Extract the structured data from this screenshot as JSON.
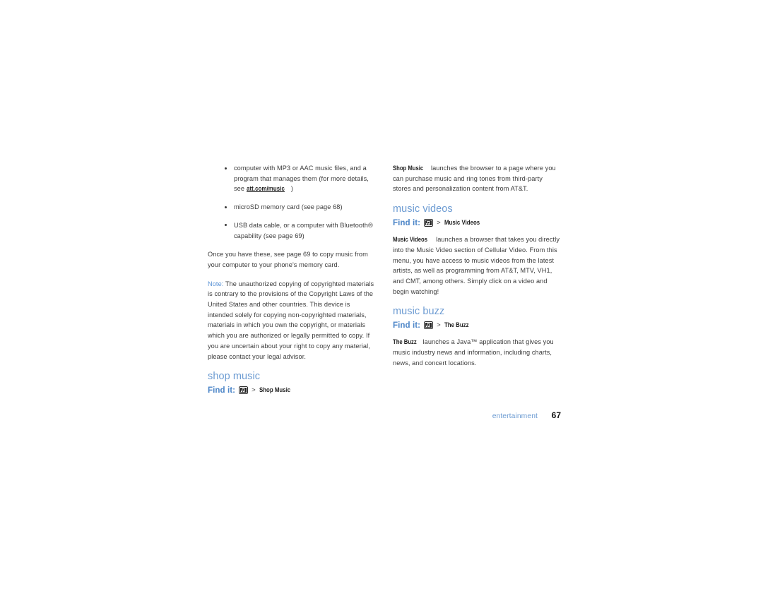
{
  "page": {
    "footer_chapter": "entertainment",
    "footer_page_number": "67"
  },
  "left_column": {
    "bullets": [
      {
        "pre": "computer with MP3 or AAC music files, and a program that manages them (for more details, see ",
        "link": "att.com/music",
        "post": ")"
      },
      {
        "pre": "microSD memory card (see page 68)",
        "link": "",
        "post": ""
      },
      {
        "pre": "USB data cable, or a computer with Bluetooth® capability (see page 69)",
        "link": "",
        "post": ""
      }
    ],
    "paragraph_copy_music": "Once you have these, see page 69 to copy music from your computer to your phone's memory card.",
    "note_label": "Note:",
    "note_text": " The unauthorized copying of copyrighted materials is contrary to the provisions of the Copyright Laws of the United States and other countries. This device is intended solely for copying non-copyrighted materials, materials in which you own the copyright, or materials which you are authorized or legally permitted to copy. If you are uncertain about your right to copy any material, please contact your legal advisor.",
    "shop_music": {
      "heading": "shop music",
      "find_it_label": "Find it:",
      "find_it_icon": "music-menu-icon",
      "find_it_separator": ">",
      "find_it_path": "Shop Music"
    }
  },
  "right_column": {
    "shop_music_desc": {
      "term": "Shop Music",
      "text": " launches the browser to a page where you can purchase music and ring tones from third-party stores and personalization content from AT&T."
    },
    "music_videos": {
      "heading": "music videos",
      "find_it_label": "Find it:",
      "find_it_icon": "music-menu-icon",
      "find_it_separator": ">",
      "find_it_path": "Music Videos",
      "term": "Music Videos",
      "text": " launches a browser that takes you directly into the Music Video section of Cellular Video.  From this menu, you have access to music videos from the latest artists, as well as programming from AT&T, MTV, VH1, and CMT, among others.  Simply click on a video and begin watching!"
    },
    "music_buzz": {
      "heading": "music buzz",
      "find_it_label": "Find it:",
      "find_it_icon": "music-menu-icon",
      "find_it_separator": ">",
      "find_it_path": "The Buzz",
      "term": "The Buzz",
      "text": " launches a Java™ application that gives you music industry news and information, including charts, news, and concert locations."
    }
  },
  "colors": {
    "heading_blue": "#6c9bd2",
    "find_it_blue": "#4d86c8",
    "body_gray": "#3b3b3b",
    "page_number_black": "#111111"
  }
}
